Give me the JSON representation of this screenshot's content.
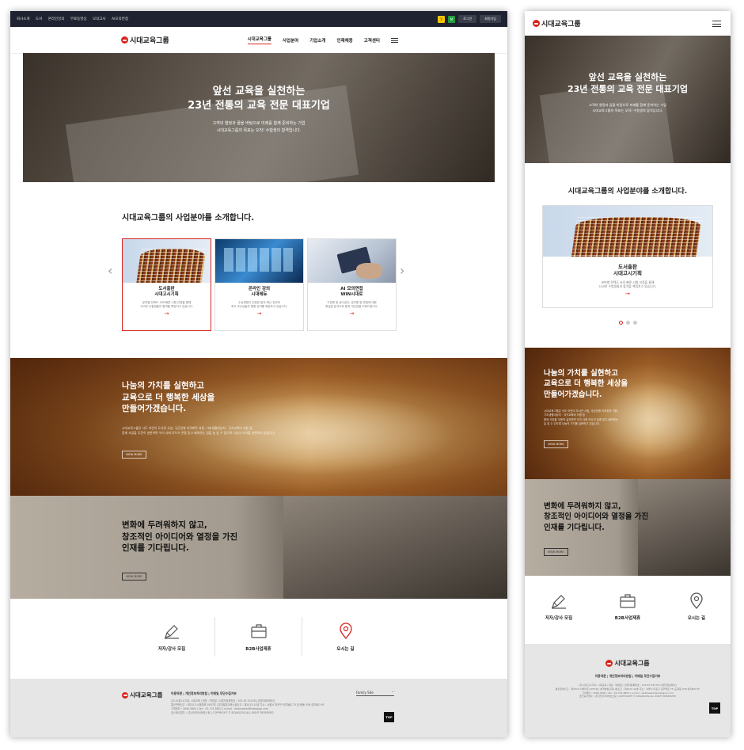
{
  "util_links": [
    "회사소개",
    "도서",
    "온라인강의",
    "무료동영상",
    "모의고사",
    "AI모의면접"
  ],
  "util_buttons": {
    "login": "로그인",
    "join": "회원가입",
    "y": "Y",
    "g": "M"
  },
  "logo": "시대교육그룹",
  "nav": [
    "시대교육그룹",
    "사업분야",
    "기업소개",
    "인재채용",
    "고객센터"
  ],
  "hero": {
    "title1": "앞선 교육을 실천하는",
    "title2": "23년 전통의 교육 전문 대표기업",
    "sub1": "고객의 열정과 꿈을 바탕으로 미래를 함께 준비하는 기업",
    "sub2": "시대교육그룹의 목표는 오직! 수험생의 합격입니다."
  },
  "biz": {
    "title": "시대교육그룹의 사업분야를 소개합니다.",
    "cards": [
      {
        "k1": "도서출판",
        "k2": "시대고시기획",
        "d1": "분야별 전택도 서의 빠른 시험 선정을 통해",
        "d2": "100만 수험생들의 합격을 책임지고 있습니다."
      },
      {
        "k1": "온라인 강의",
        "k2": "시대에듀",
        "d1": "수상경험이 인정한 없의 혁신 강의와",
        "d2": "최고 교수님들의 명품 강의를 제공하고 있습니다."
      },
      {
        "k1": "AI 모의면접",
        "k2": "WIN시대로",
        "d1": "기업체 및 공사공단, 공무원 등 면접에 대한",
        "d2": "확실한 분석으로 합격 여신감을 키워드립니다."
      }
    ]
  },
  "share": {
    "l1": "나눔의 가치를 실현하고",
    "l2": "교육으로 더 행복한 세상을",
    "l3": "만들어가겠습니다.",
    "p1": "시대교육그룹은 낙도 어린이 도서관 사업, 국군장병 자격취득 지원, 기초생활대상자 · 국가교육비 지원 등",
    "p2": "함께 사업을 무문히 실천하며 우리 사회 모두가 존중 받고 배려하는 길을 늘 앞 수 있도록 나눔의 가치를 실현하고 있습니다.",
    "mp1": "시대교육그룹은 낙도 어린이 도서관 사업, 국군장병 자격취득 지원,",
    "mp2": "기초생활대상자 · 국가교육비 지원 등",
    "mp3": "함께 사업을 무문히 실천하며 우리 사회 모두가 존중 받고 배려하는",
    "mp4": "늘 앞 수 있도록 나눔의 가치를 실현하고 있습니다.",
    "btn": "VIEW MORE"
  },
  "recruit": {
    "l1": "변화에 두려워하지 않고,",
    "l2": "창조적인 아이디어와 열정을 가진",
    "l3": "인재를 기다립니다.",
    "btn": "VIEW MORE"
  },
  "quick": [
    {
      "label": "저자/강사 모집",
      "icon": "pen-icon"
    },
    {
      "label": "B2B사업제휴",
      "icon": "briefcase-icon"
    },
    {
      "label": "오시는 길",
      "icon": "map-pin-icon"
    }
  ],
  "footer": {
    "links": "이용약관  |  개인정보처리방침  |  이메일 무단수집거부",
    "i1": "(주)시대고시기획, 시대교육 | 대표 : 박영일 | 사업자등록번호 : 105-87-52478 [사업자정보확인]",
    "i2": "통신판매신고 : 제2013-서울마포-0057호 | 본개발본교육시설신고 : 제2015-10호 주소 : 서울시 마포구 큰우물로 75 [도화동 538 성지B/D 9F",
    "i3": "고객센터 : 1600-3600 | fax : 02-701-8823 | e-mail : webmaster@sdaegosi.com",
    "i4": "호스팅사업자 : (주)코리아서버호스팅 | COPYRIGHT © SIDAEGOSI.ALL RIGHT RESERVED",
    "family": "Family Site",
    "top": "TOP"
  },
  "colors": {
    "accent": "#d7261e",
    "utilbar": "#1f2230",
    "footer": "#e6e6e6"
  }
}
